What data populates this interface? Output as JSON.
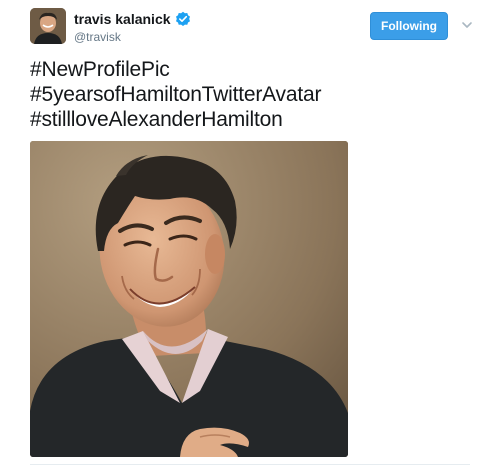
{
  "tweet": {
    "author": {
      "fullname": "travis kalanick",
      "username": "@travisk",
      "verified": true,
      "avatar_icon": "profile-photo"
    },
    "follow_button_label": "Following",
    "hashtags": [
      "#NewProfilePic",
      "#5yearsofHamiltonTwitterAvatar",
      "#stillloveAlexanderHamilton"
    ],
    "media": {
      "type": "photo",
      "icon": "portrait-photo"
    }
  },
  "colors": {
    "follow_button": "#3b9ee8",
    "verified_badge": "#1da1f2",
    "username": "#657786",
    "text": "#14171a",
    "photo_background": "#8f7b60"
  }
}
